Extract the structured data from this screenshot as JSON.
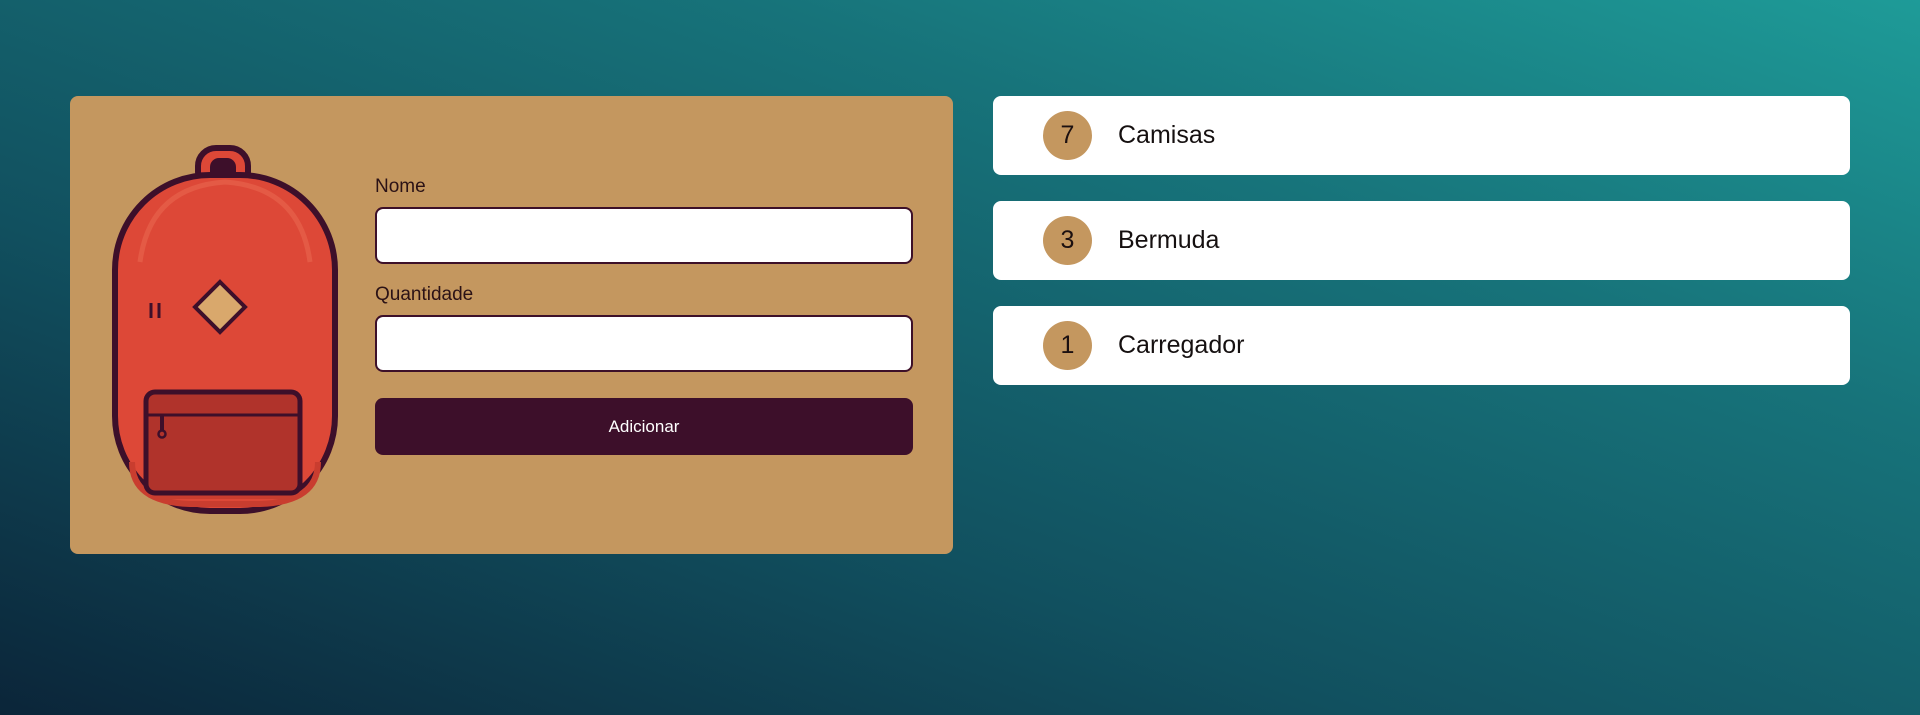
{
  "form": {
    "name_label": "Nome",
    "name_value": "",
    "quantity_label": "Quantidade",
    "quantity_value": "",
    "submit_label": "Adicionar"
  },
  "items": [
    {
      "quantity": "7",
      "name": "Camisas"
    },
    {
      "quantity": "3",
      "name": "Bermuda"
    },
    {
      "quantity": "1",
      "name": "Carregador"
    }
  ],
  "colors": {
    "card": "#c4975f",
    "button": "#3d0f2a",
    "backpack_body": "#dd4837",
    "backpack_outline": "#3d0f2a",
    "background_dark": "#0b2539",
    "background_light": "#1e9b98"
  },
  "icons": {
    "illustration": "backpack-illustration"
  }
}
